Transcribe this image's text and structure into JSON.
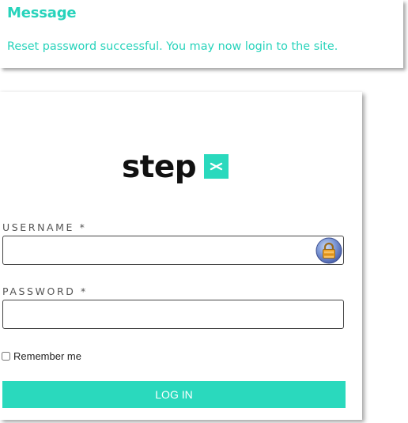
{
  "message": {
    "title": "Message",
    "text": "Reset password successful. You may now login to the site."
  },
  "logo": {
    "text": "step",
    "mark_icon": "x-mark-icon"
  },
  "login_form": {
    "username_label": "USERNAME *",
    "username_value": "",
    "password_label": "PASSWORD *",
    "password_value": "",
    "password_manager_icon": "lock-icon",
    "remember_label": "Remember me",
    "remember_checked": false,
    "submit_label": "LOG IN"
  },
  "colors": {
    "accent": "#2ad9bd",
    "message_text": "#27d3bb",
    "label": "#555555"
  }
}
